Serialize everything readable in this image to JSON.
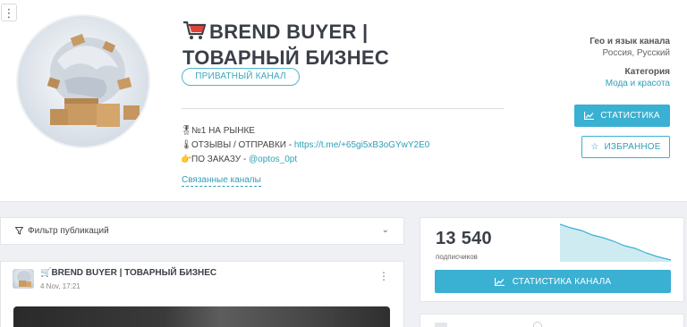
{
  "channel": {
    "title_line1": "BREND BUYER |",
    "title_line2": "ТОВАРНЫЙ БИЗНЕС",
    "private_badge": "ПРИВАТНЫЙ КАНАЛ",
    "description": [
      {
        "icon": "medal-icon",
        "text": "№1 НА РЫНКЕ",
        "link": ""
      },
      {
        "icon": "thermometer-icon",
        "text": "ОТЗЫВЫ / ОТПРАВКИ - ",
        "link": "https://t.me/+65gi5xB3oGYwY2E0"
      },
      {
        "icon": "pointing-hand-icon",
        "text": "ПО ЗАКАЗУ - ",
        "link": "@optos_0pt"
      }
    ],
    "related_link": "Связанные каналы"
  },
  "meta": {
    "geo_label": "Гео и язык канала",
    "geo_value": "Россия, Русский",
    "category_label": "Категория",
    "category_value": "Мода и красота"
  },
  "buttons": {
    "stats": "СТАТИСТИКА",
    "favorite": "ИЗБРАННОЕ",
    "channel_stats": "СТАТИСТИКА КАНАЛА"
  },
  "filter": {
    "label": "Фильтр публикаций"
  },
  "post": {
    "title": "BREND BUYER | ТОВАРНЫЙ БИЗНЕС",
    "date": "4 Nov, 17:21"
  },
  "subscribers": {
    "count": "13 540",
    "label": "подписчиков"
  },
  "colors": {
    "accent": "#3ab0d2",
    "link": "#2f9fb6",
    "chart_fill": "#cdebf1"
  }
}
